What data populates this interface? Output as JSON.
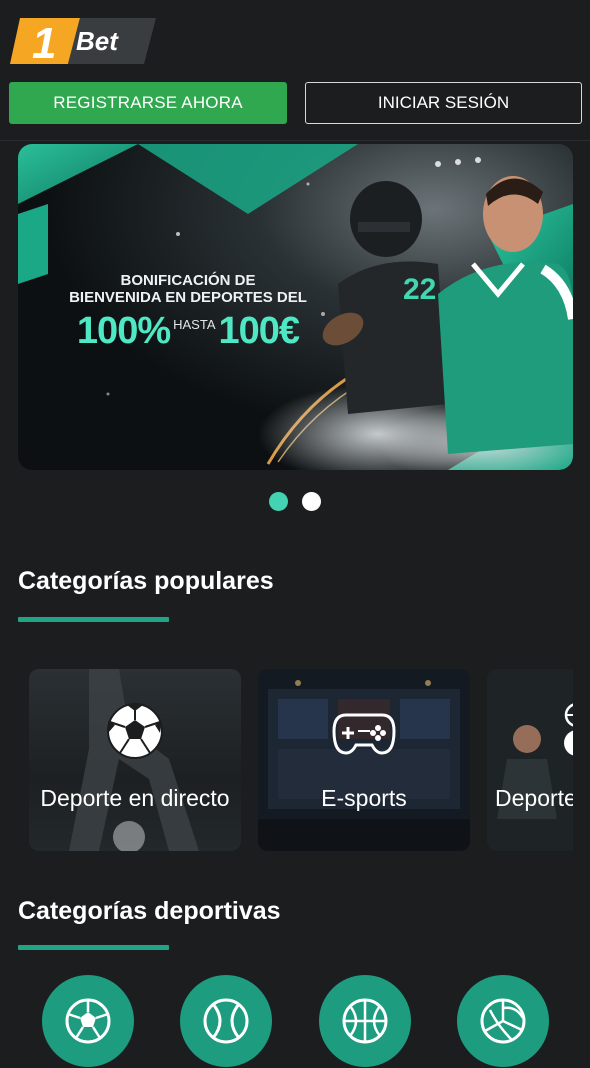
{
  "header": {
    "logo_number": "1",
    "logo_text": "Bet",
    "register_label": "REGISTRARSE AHORA",
    "login_label": "INICIAR SESIÓN"
  },
  "banner": {
    "line1": "BONIFICACIÓN DE",
    "line2": "BIENVENIDA EN DEPORTES DEL",
    "percent": "100%",
    "hasta": "HASTA",
    "amount": "100€",
    "jersey_number": "22",
    "slide_count": 2,
    "active_slide": 1
  },
  "popular": {
    "title": "Categorías populares",
    "cards": [
      {
        "label": "Deporte en directo",
        "icon": "soccer-ball-icon"
      },
      {
        "label": "E-sports",
        "icon": "gamepad-icon"
      },
      {
        "label": "Deportes",
        "icon": "sports-balls-icon"
      }
    ]
  },
  "sports": {
    "title": "Categorías deportivas",
    "items": [
      {
        "icon": "soccer-ball-icon"
      },
      {
        "icon": "tennis-ball-icon"
      },
      {
        "icon": "basketball-icon"
      },
      {
        "icon": "volleyball-icon"
      }
    ]
  },
  "colors": {
    "background": "#1b1d1f",
    "register_green": "#2fa84f",
    "accent_teal": "#1fa585",
    "banner_teal": "#4ee8c5",
    "circle_teal": "#1d9c7f",
    "logo_orange": "#f5a623"
  }
}
